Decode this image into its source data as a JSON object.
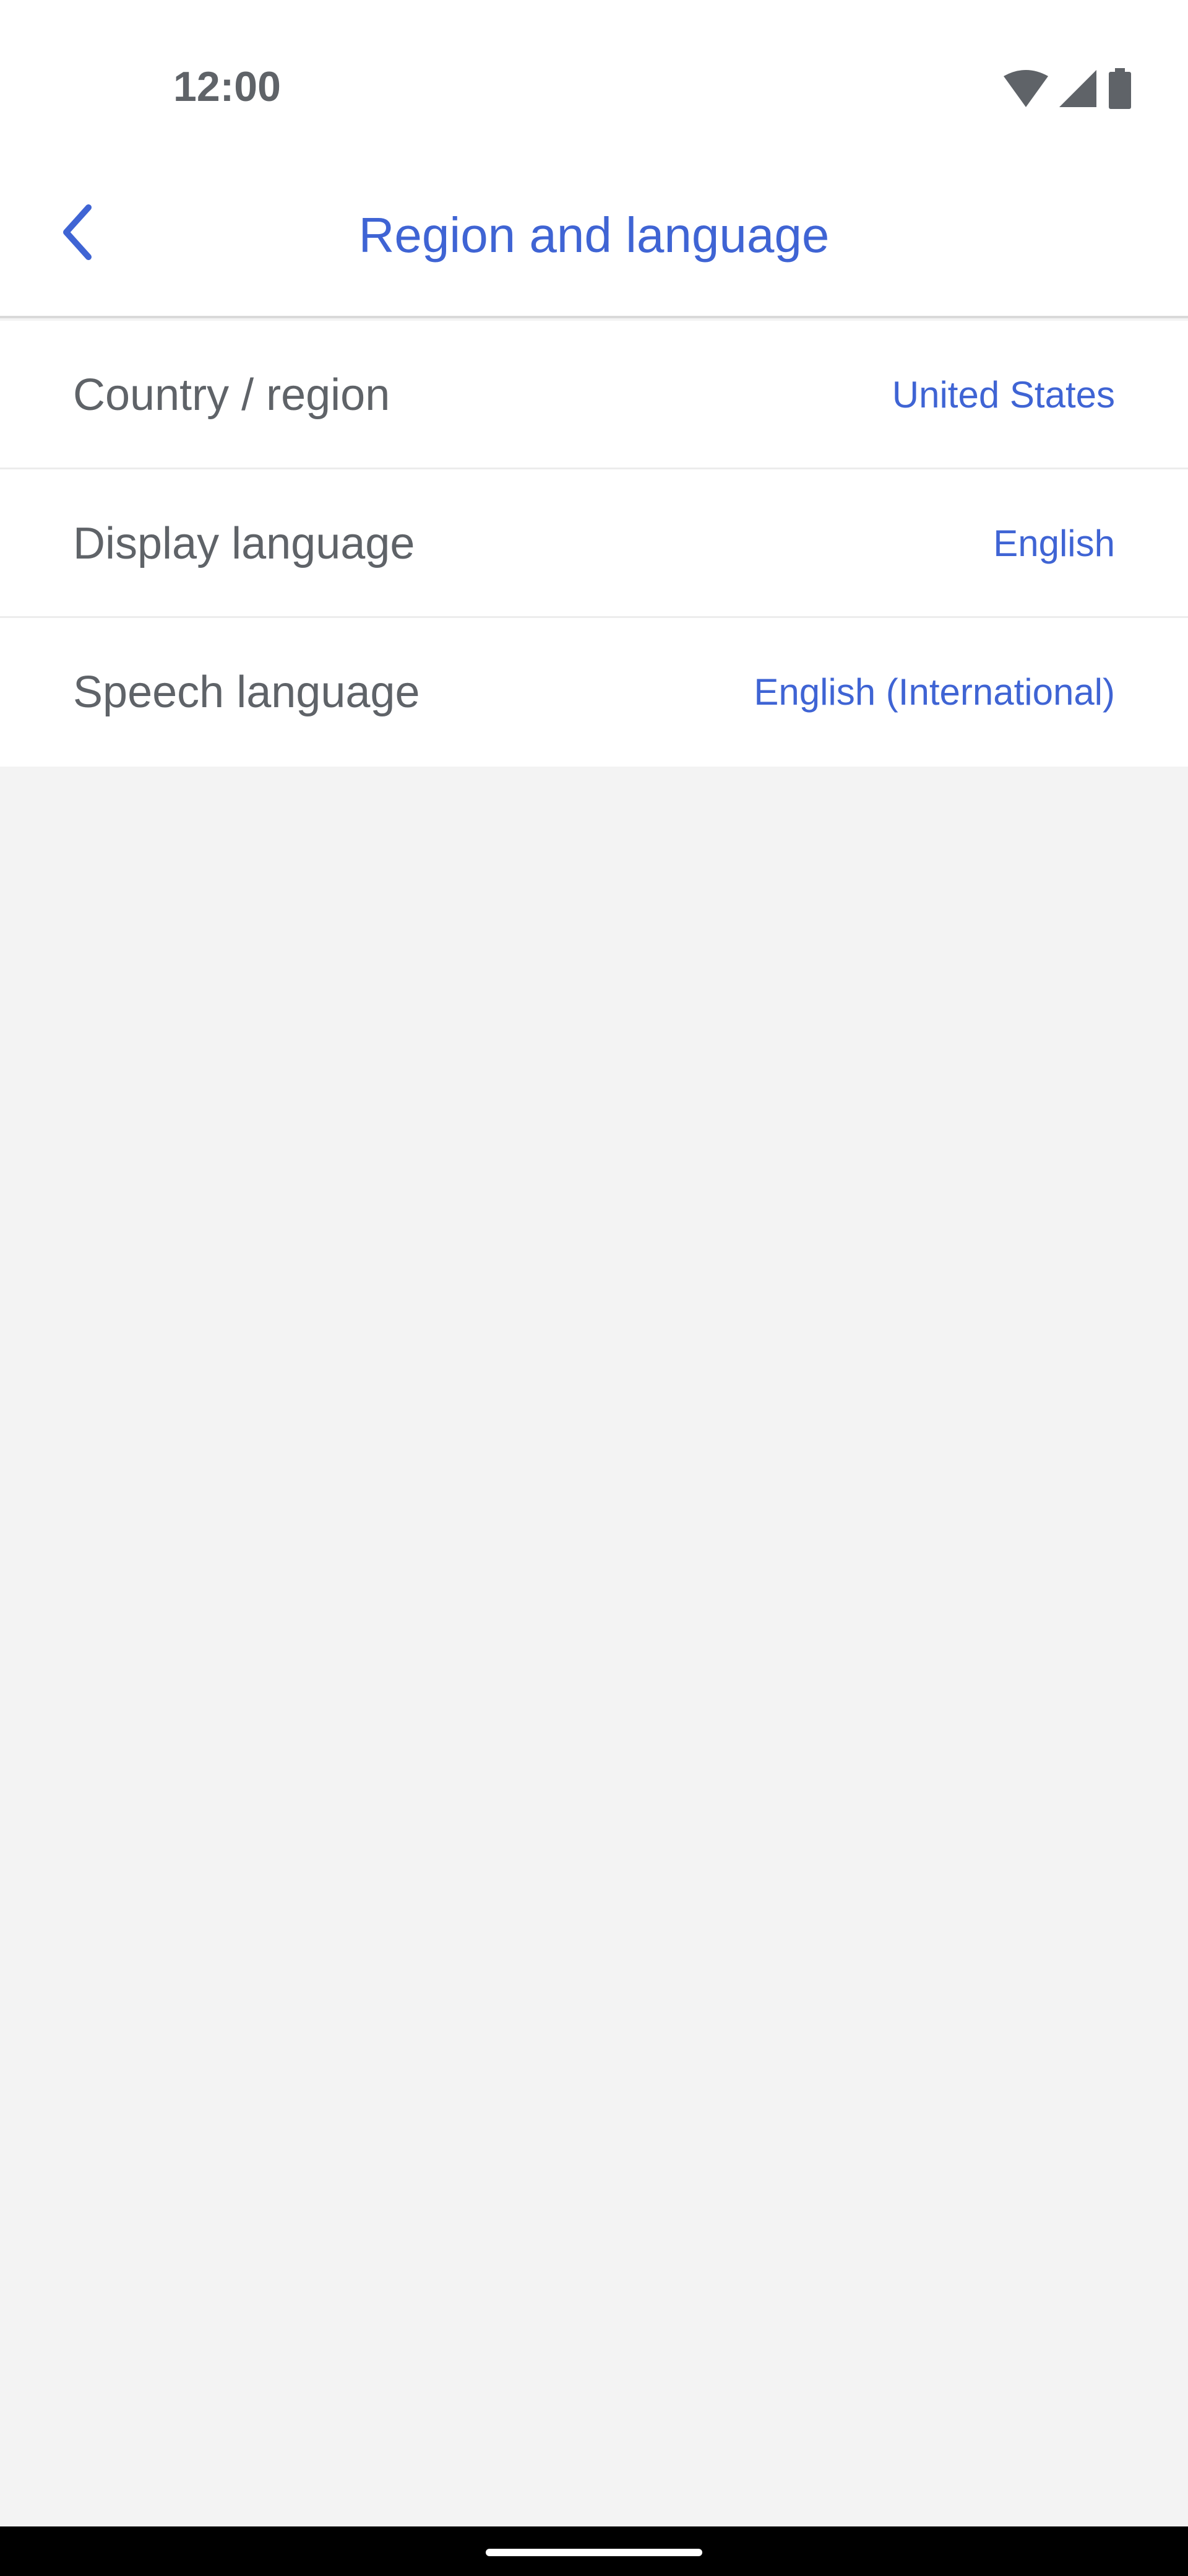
{
  "status_bar": {
    "time": "12:00",
    "icons": [
      "wifi-icon",
      "cell-signal-icon",
      "battery-icon"
    ]
  },
  "app_bar": {
    "back_icon": "chevron-left-icon",
    "title": "Region and language"
  },
  "settings": [
    {
      "label": "Country / region",
      "value": "United States"
    },
    {
      "label": "Display language",
      "value": "English"
    },
    {
      "label": "Speech language",
      "value": "English (International)"
    }
  ],
  "colors": {
    "accent": "#3f64d4",
    "label_text": "#5f6368",
    "surface": "#ffffff",
    "background": "#f3f3f3",
    "nav_bar": "#000000"
  }
}
